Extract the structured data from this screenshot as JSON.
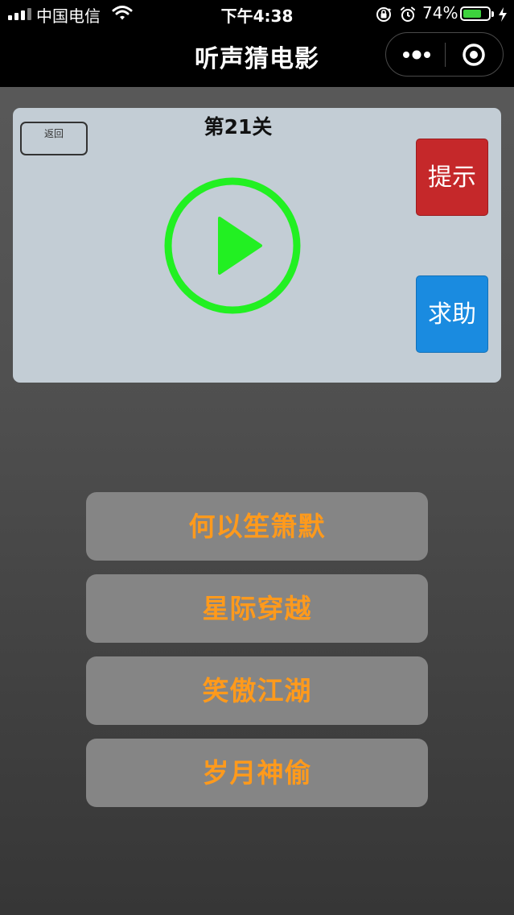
{
  "status_bar": {
    "carrier": "中国电信",
    "time": "下午4:38",
    "battery_percent_text": "74%",
    "battery_level": 0.74,
    "signal_bars_total": 5,
    "signal_bars_filled": 3,
    "icons": [
      "signal-icon",
      "wifi-icon",
      "orientation-lock-icon",
      "alarm-icon",
      "battery-icon",
      "charging-bolt-icon"
    ]
  },
  "nav": {
    "title": "听声猜电影",
    "more_icon": "more-dots-icon",
    "close_icon": "target-circle-icon"
  },
  "game": {
    "back_label": "返回",
    "level_label": "第21关",
    "play_icon": "play-circle-icon",
    "play_color": "#22f022",
    "hint_label": "提示",
    "hint_color": "#c5282a",
    "help_label": "求助",
    "help_color": "#1a8be0"
  },
  "options": [
    "何以笙箫默",
    "星际穿越",
    "笑傲江湖",
    "岁月神偷"
  ],
  "colors": {
    "option_text": "#ff9a1c",
    "option_bg": "#858585",
    "card_bg": "#c3cdd5"
  }
}
